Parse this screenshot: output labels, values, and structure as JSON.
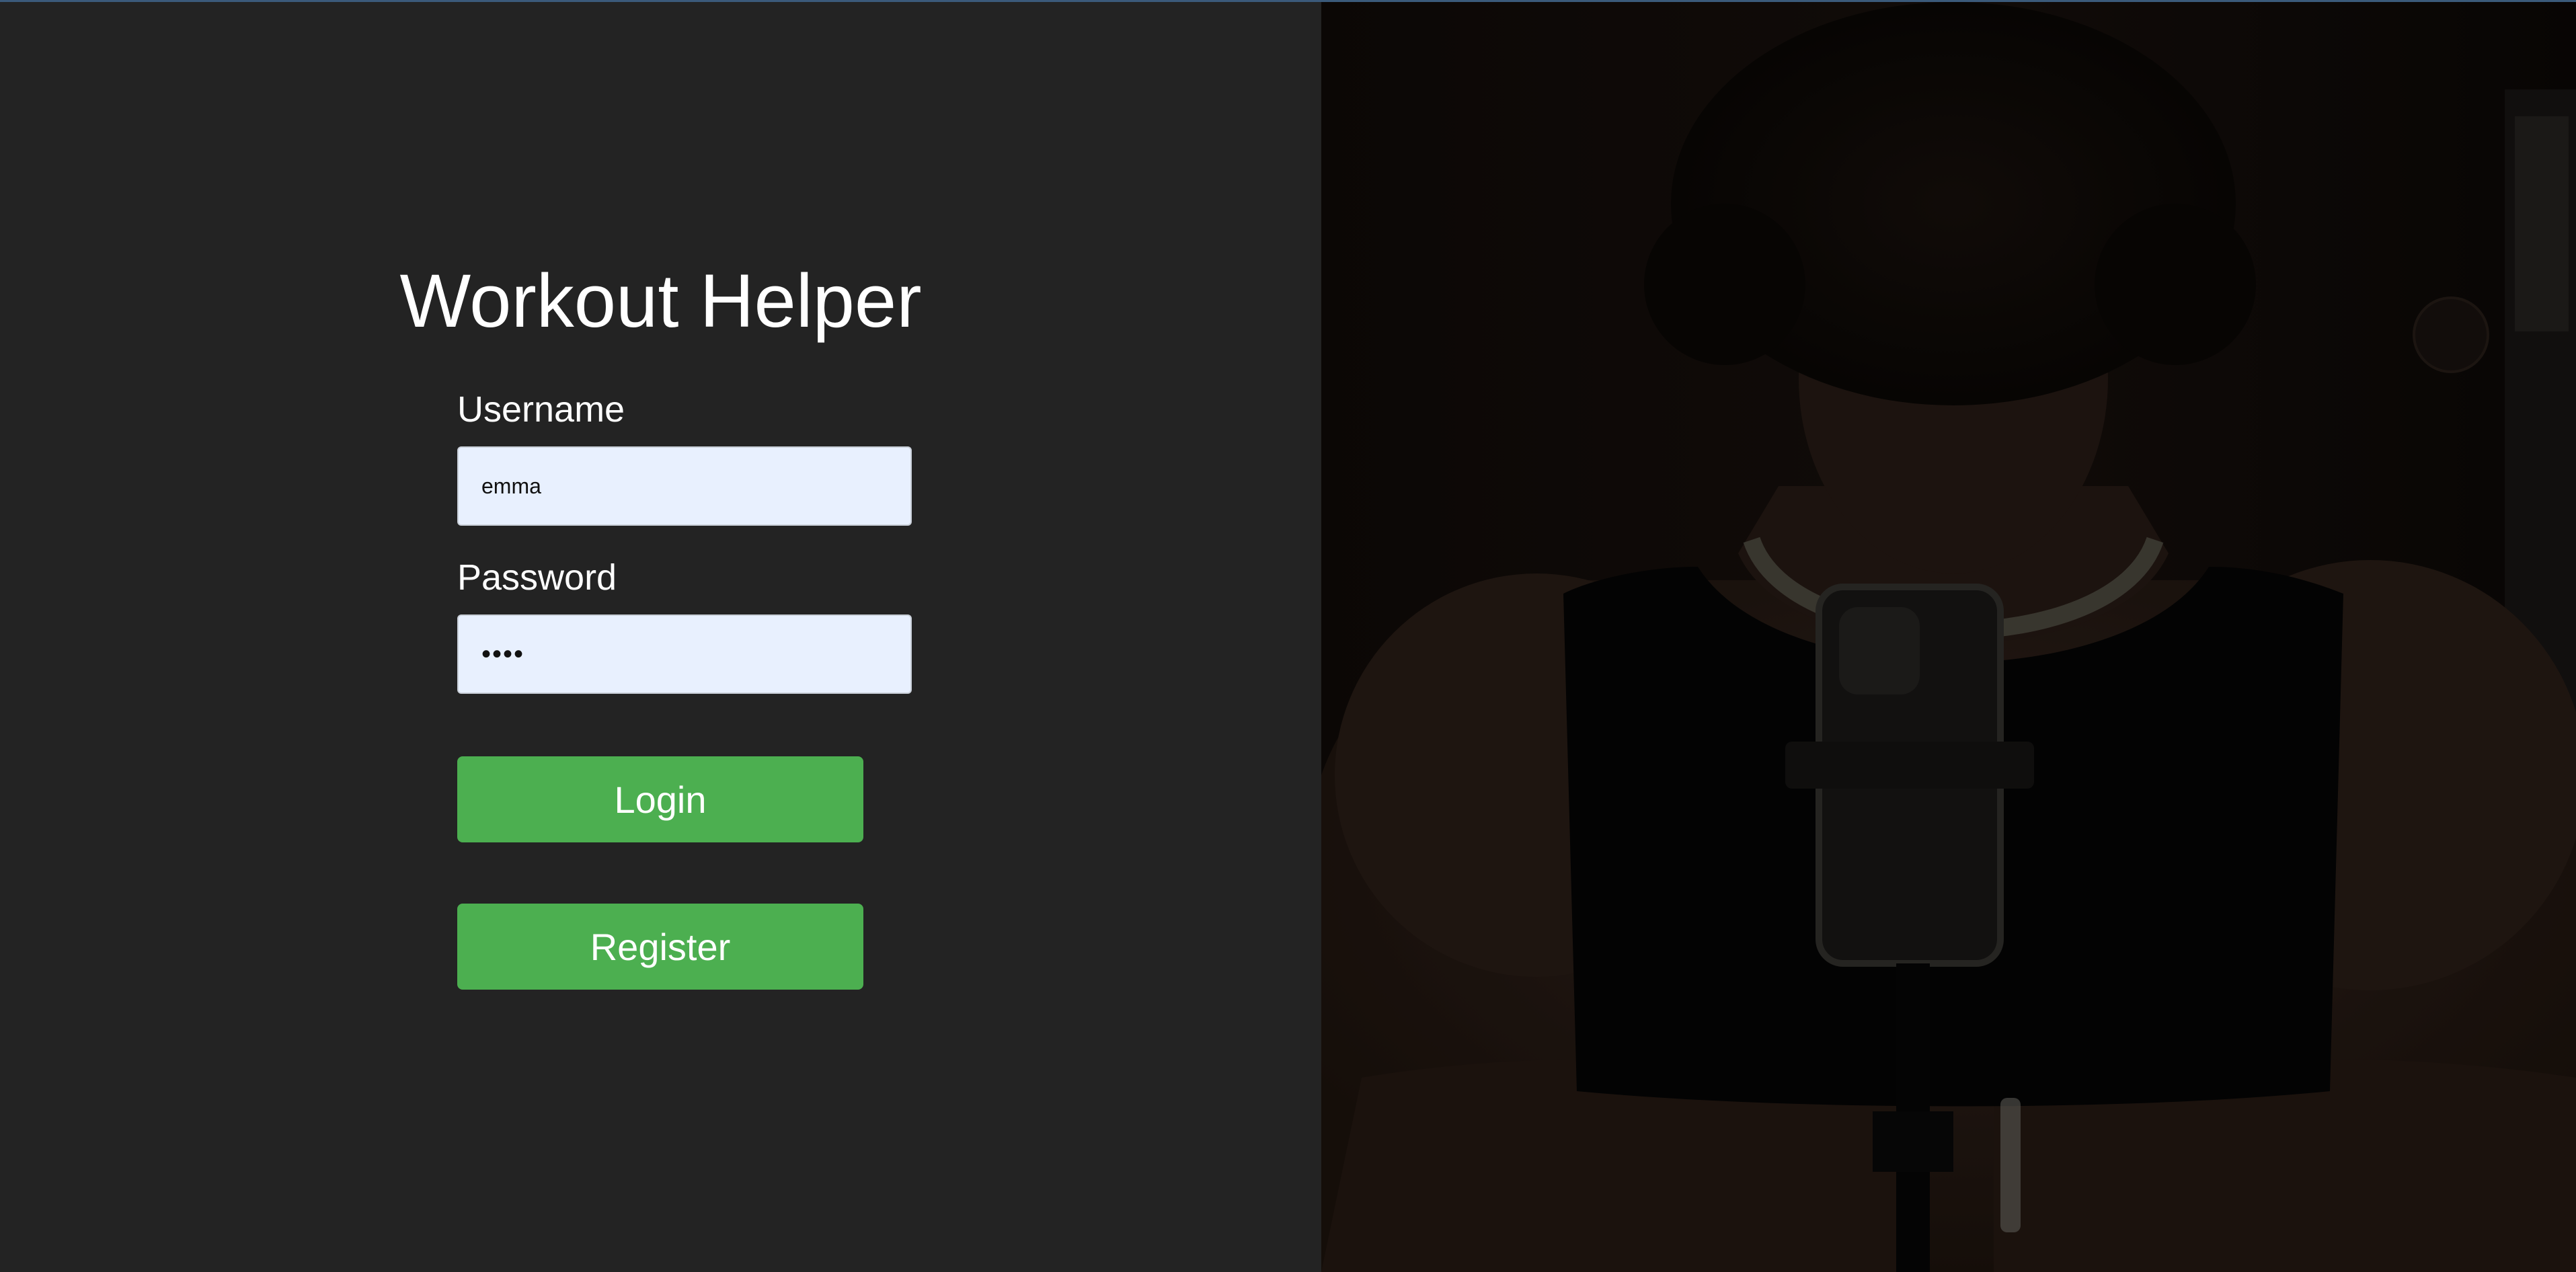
{
  "app": {
    "title": "Workout Helper"
  },
  "login_form": {
    "username_label": "Username",
    "username_value": "emma",
    "password_label": "Password",
    "password_value": "••••",
    "login_label": "Login",
    "register_label": "Register"
  },
  "colors": {
    "background": "#232323",
    "input_background": "#e8f0fe",
    "button_green": "#4caf50",
    "text": "#ffffff"
  },
  "hero_image": {
    "icon": "gym-mirror-selfie-photo"
  }
}
